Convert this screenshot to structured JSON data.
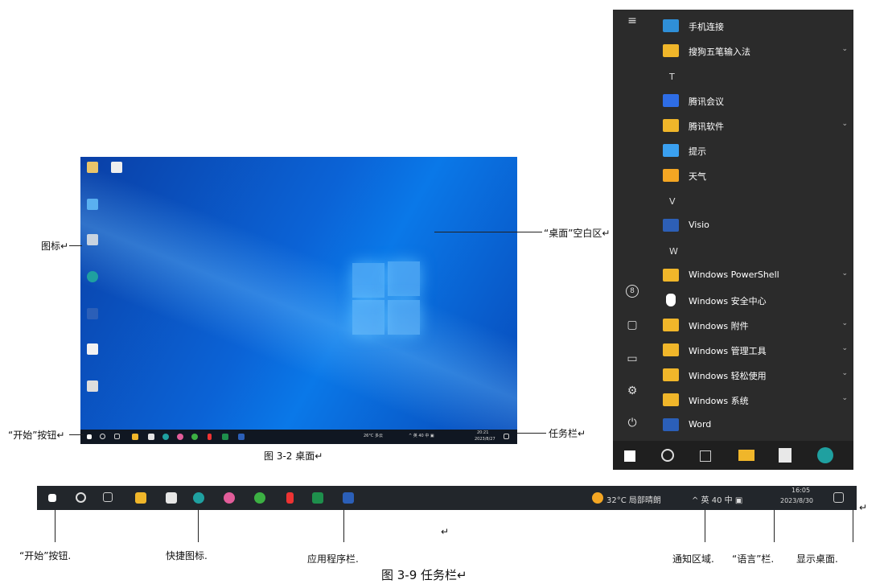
{
  "figure1": {
    "caption": "图 3-2   桌面↵",
    "annotations": {
      "icons": "图标↵",
      "desktop_blank": "“桌面”空白区↵",
      "start_button": "“开始”按钮↵",
      "taskbar": "任务栏↵"
    },
    "desktop_taskbar": {
      "weather": "26°C 多云",
      "tray": "^ 英 40 中 ▣",
      "time": "20:21",
      "date": "2023/8/27"
    }
  },
  "start_menu": {
    "items": [
      {
        "label": "手机连接",
        "color": "#2f8fd8",
        "chevron": false
      },
      {
        "label": "搜狗五笔输入法",
        "color": "#f0b62a",
        "chevron": true
      },
      {
        "letter": "T"
      },
      {
        "label": "腾讯会议",
        "color": "#2e6de6",
        "chevron": false
      },
      {
        "label": "腾讯软件",
        "color": "#f0b62a",
        "chevron": true
      },
      {
        "label": "提示",
        "color": "#3aa0f0",
        "chevron": false
      },
      {
        "label": "天气",
        "color": "#f4a623",
        "chevron": false
      },
      {
        "letter": "V"
      },
      {
        "label": "Visio",
        "color": "#2d5fb6",
        "chevron": false
      },
      {
        "letter": "W"
      },
      {
        "label": "Windows PowerShell",
        "color": "#f0b62a",
        "chevron": true
      },
      {
        "label": "Windows 安全中心",
        "color": "#ffffff",
        "chevron": false
      },
      {
        "label": "Windows 附件",
        "color": "#f0b62a",
        "chevron": true
      },
      {
        "label": "Windows 管理工具",
        "color": "#f0b62a",
        "chevron": true
      },
      {
        "label": "Windows 轻松使用",
        "color": "#f0b62a",
        "chevron": true
      },
      {
        "label": "Windows 系统",
        "color": "#f0b62a",
        "chevron": true
      },
      {
        "label": "Word",
        "color": "#2b5fb8",
        "chevron": false
      }
    ],
    "chevron_glyph": "⌄"
  },
  "figure2": {
    "caption": "图 3-9    任务栏↵",
    "return_mark": "↵",
    "weather": "32°C 局部晴朗",
    "tray": "^ 英 40 中 ▣",
    "time": "16:05",
    "date": "2023/8/30",
    "labels": {
      "start": "“开始”按钮.",
      "quick": "快捷图标.",
      "apps": "应用程序栏.",
      "notify": "通知区域.",
      "lang": "“语言”栏.",
      "show_desktop": "显示桌面."
    }
  }
}
